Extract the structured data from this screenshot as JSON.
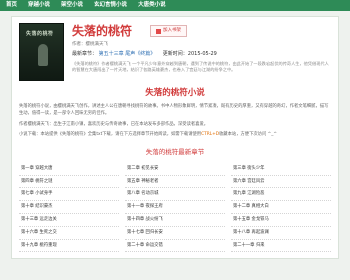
{
  "nav": [
    "首页",
    "穿越小说",
    "架空小说",
    "玄幻言情小说",
    "大唐类小说"
  ],
  "book": {
    "cover_title": "失落的桃符",
    "title": "失落的桃符",
    "badge_icon": "bookmark-icon",
    "badge": "加入书架",
    "author": "作者：樱桃满天飞",
    "latest_label": "最新章节：",
    "latest_chapter": "第五十三章 尾声《终篇》",
    "latest_time": "更新时间：2015-05-29",
    "intro": "《失落的桃符》作者樱桃满天飞 一个平凡少年意外穿越到唐朝，遇到了传说中的桃符，由此开始了一段跌宕起伏的传奇人生，他凭借现代人的智慧在大唐闯出了一片天地，结识了各路英雄豪杰，也卷入了宫廷与江湖的纷争之中。"
  },
  "section": {
    "title": "失落的桃符小说",
    "p1": "失落的桃符小说，由樱桃满天飞创作，讲述主人公在唐朝寻找桃符的故事。书中人物形象鲜明，情节紧凑，既有历史的厚重，又有穿越的奇幻，作者文笔细腻，描写生动，值得一读，是一部令人回味无穷的佳作。",
    "p2": "作者樱桃满天飞：出生于江南小镇，喜欢历史与传奇故事，已在本站发布多部作品，深受读者喜爱。",
    "p3_pre": "小说下载：本站提供《失落的桃符》全集txt下载，请在下方选择章节开始阅读，如需下载请使用",
    "p3_hl": "CTRL+D",
    "p3_post": "收藏本站，方便下次访问 ^_^"
  },
  "chapters_title": "失落的桃符最新章节",
  "chapters": [
    "第一章 穿越大唐",
    "第二章 初见长安",
    "第三章 街头少年",
    "第四章 桃符之谜",
    "第五章 神秘老者",
    "第六章 宫廷风云",
    "第七章 小试身手",
    "第八章 名动京城",
    "第九章 江湖险恶",
    "第十章 结识豪杰",
    "第十一章 夜探王府",
    "第十二章 真相大白",
    "第十三章 远走边关",
    "第十四章 战火纷飞",
    "第十五章 金戈铁马",
    "第十六章 生死之交",
    "第十七章 回归长安",
    "第十八章 再起波澜",
    "第十九章 桃符重现",
    "第二十章 命运交错",
    "第二十一章 归来"
  ]
}
